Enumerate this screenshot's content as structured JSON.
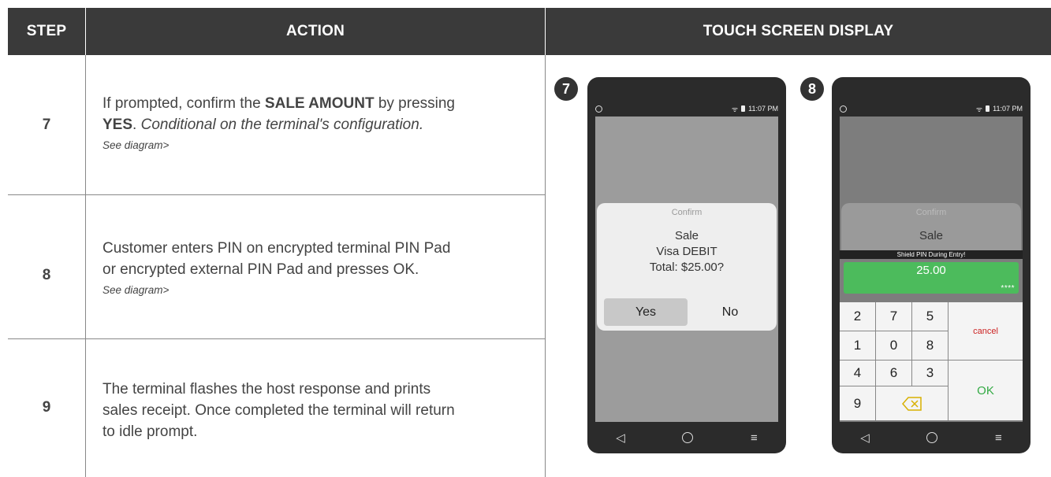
{
  "headers": {
    "step": "STEP",
    "action": "ACTION",
    "display": "TOUCH SCREEN DISPLAY"
  },
  "rows": [
    {
      "step": "7",
      "text_a": "If prompted, confirm the ",
      "bold_a": "SALE AMOUNT",
      "text_b": " by pressing",
      "bold_b": "YES",
      "text_c": ". ",
      "italic": "Conditional on the terminal's configuration.",
      "see": "See diagram>"
    },
    {
      "step": "8",
      "line1": "Customer enters PIN on encrypted terminal PIN Pad",
      "line2": "or encrypted external PIN Pad and presses OK.",
      "see": "See diagram>"
    },
    {
      "step": "9",
      "line1": "The terminal flashes the host response and prints",
      "line2": "sales receipt. Once completed the terminal will return",
      "line3": "to idle prompt."
    }
  ],
  "screen7": {
    "badge": "7",
    "time": "11:07 PM",
    "dialog": {
      "title": "Confirm",
      "line1": "Sale",
      "line2": "Visa DEBIT",
      "line3": "Total: $25.00?",
      "yes": "Yes",
      "no": "No"
    }
  },
  "screen8": {
    "badge": "8",
    "time": "11:07 PM",
    "dialog": {
      "title": "Confirm",
      "line1": "Sale"
    },
    "shield": "Shield PIN During Entry!",
    "amount": "25.00",
    "mask": "****",
    "keys": [
      "2",
      "7",
      "5",
      "1",
      "0",
      "8",
      "4",
      "6",
      "3",
      "9"
    ],
    "cancel": "cancel",
    "ok": "OK"
  },
  "nav": {
    "back": "◁",
    "menu": "≡"
  },
  "colors": {
    "header_bg": "#3a3a3a",
    "pin_green": "#4cbb5c",
    "cancel_red": "#cc2222",
    "ok_green": "#33aa44"
  }
}
